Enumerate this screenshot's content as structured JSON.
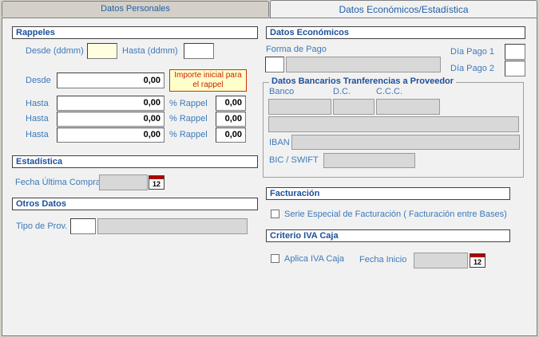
{
  "tabs": [
    "Datos Personales",
    "Datos Económicos/Estadística"
  ],
  "rappeles": {
    "title": "Rappeles",
    "desde_ddmm": "Desde (ddmm)",
    "hasta_ddmm": "Hasta  (ddmm)",
    "desde": "Desde",
    "desde_value": "0,00",
    "note": "Importe inicial para el rappel",
    "rows": [
      {
        "label": "Hasta",
        "value": "0,00",
        "pct_label": "% Rappel",
        "pct": "0,00"
      },
      {
        "label": "Hasta",
        "value": "0,00",
        "pct_label": "% Rappel",
        "pct": "0,00"
      },
      {
        "label": "Hasta",
        "value": "0,00",
        "pct_label": "% Rappel",
        "pct": "0,00"
      }
    ]
  },
  "estadistica": {
    "title": "Estadística",
    "fecha_label": "Fecha Última Compra"
  },
  "otros": {
    "title": "Otros Datos",
    "tipo_label": "Tipo de Prov."
  },
  "economicos": {
    "title": "Datos Económicos",
    "forma_pago": "Forma de Pago",
    "dia_pago_1": "Día Pago 1",
    "dia_pago_2": "Día Pago 2"
  },
  "bancarios": {
    "title": "Datos Bancarios Tranferencias a Proveedor",
    "banco": "Banco",
    "dc": "D.C.",
    "ccc": "C.C.C.",
    "iban": "IBAN",
    "bic": "BIC / SWIFT"
  },
  "facturacion": {
    "title": "Facturación",
    "serie_label": "Serie Especial de Facturación ( Facturación entre Bases)"
  },
  "iva_caja": {
    "title": "Criterio IVA Caja",
    "aplica_label": "Aplica IVA Caja",
    "fecha_inicio": "Fecha Inicio"
  },
  "calendar_icon_text": "12"
}
